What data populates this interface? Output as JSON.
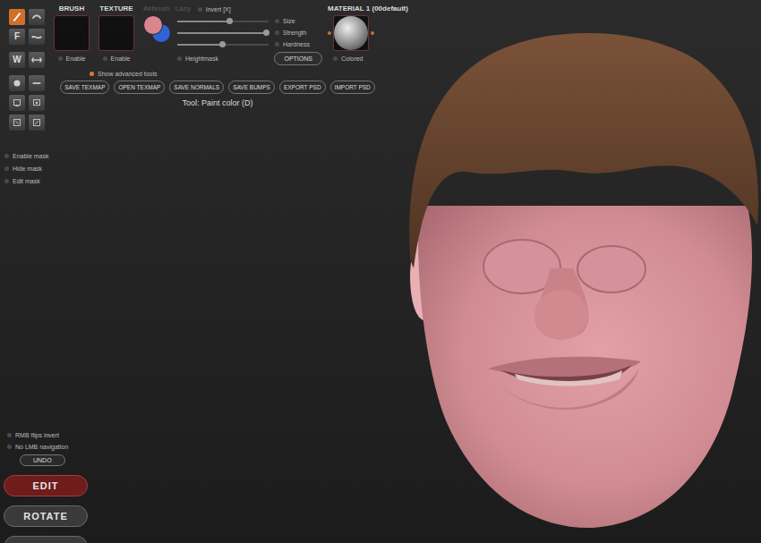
{
  "toolbar": {
    "tools": [
      {
        "selected": true
      },
      {
        "selected": false
      },
      {
        "label": "F",
        "selected": false
      },
      {
        "selected": false
      },
      {
        "label": "W",
        "selected": false
      },
      {
        "selected": false
      },
      {
        "selected": false
      },
      {
        "selected": false
      },
      {
        "selected": false
      },
      {
        "selected": false
      },
      {
        "selected": false
      },
      {
        "selected": false
      }
    ]
  },
  "brush": {
    "label": "BRUSH",
    "enable": {
      "label": "Enable",
      "checked": false
    }
  },
  "texture": {
    "label": "TEXTURE",
    "enable": {
      "label": "Enable",
      "checked": false
    }
  },
  "options": [
    {
      "kind": "text",
      "label": "Airbrush",
      "disabled": true
    },
    {
      "kind": "text",
      "label": "Lazy",
      "disabled": true
    },
    {
      "kind": "toggle",
      "label": "Invert [X]",
      "checked": false
    }
  ],
  "swatches": [
    {
      "color": "#d9868e"
    },
    {
      "color": "#2f63d6"
    }
  ],
  "sliders": [
    {
      "label": "Size",
      "level": 0.57,
      "checked": false
    },
    {
      "label": "Strength",
      "level": 0.97,
      "checked": false
    },
    {
      "label": "Hardness",
      "level": 0.49,
      "checked": false
    }
  ],
  "heightmask": {
    "label": "Heightmask",
    "checked": false
  },
  "options_button": "OPTIONS",
  "material": {
    "label": "MATERIAL 1 (00default)",
    "colored": {
      "label": "Colored",
      "checked": false
    }
  },
  "advanced": {
    "label": "Show advanced tools",
    "checked": true
  },
  "file_buttons": [
    "SAVE TEXMAP",
    "OPEN TEXMAP",
    "SAVE NORMALS",
    "SAVE BUMPS",
    "EXPORT PSD",
    "IMPORT PSD"
  ],
  "tool_status": "Tool: Paint color (D)",
  "mask_options": [
    {
      "label": "Enable mask",
      "checked": false
    },
    {
      "label": "Hide mask",
      "checked": false
    },
    {
      "label": "Edit mask",
      "checked": false
    }
  ],
  "bottom_options": [
    {
      "label": "RMB flips invert",
      "checked": false
    },
    {
      "label": "No LMB navigation",
      "checked": false
    }
  ],
  "undo": "UNDO",
  "modes": [
    {
      "label": "EDIT",
      "selected": true
    },
    {
      "label": "ROTATE",
      "selected": false
    }
  ]
}
